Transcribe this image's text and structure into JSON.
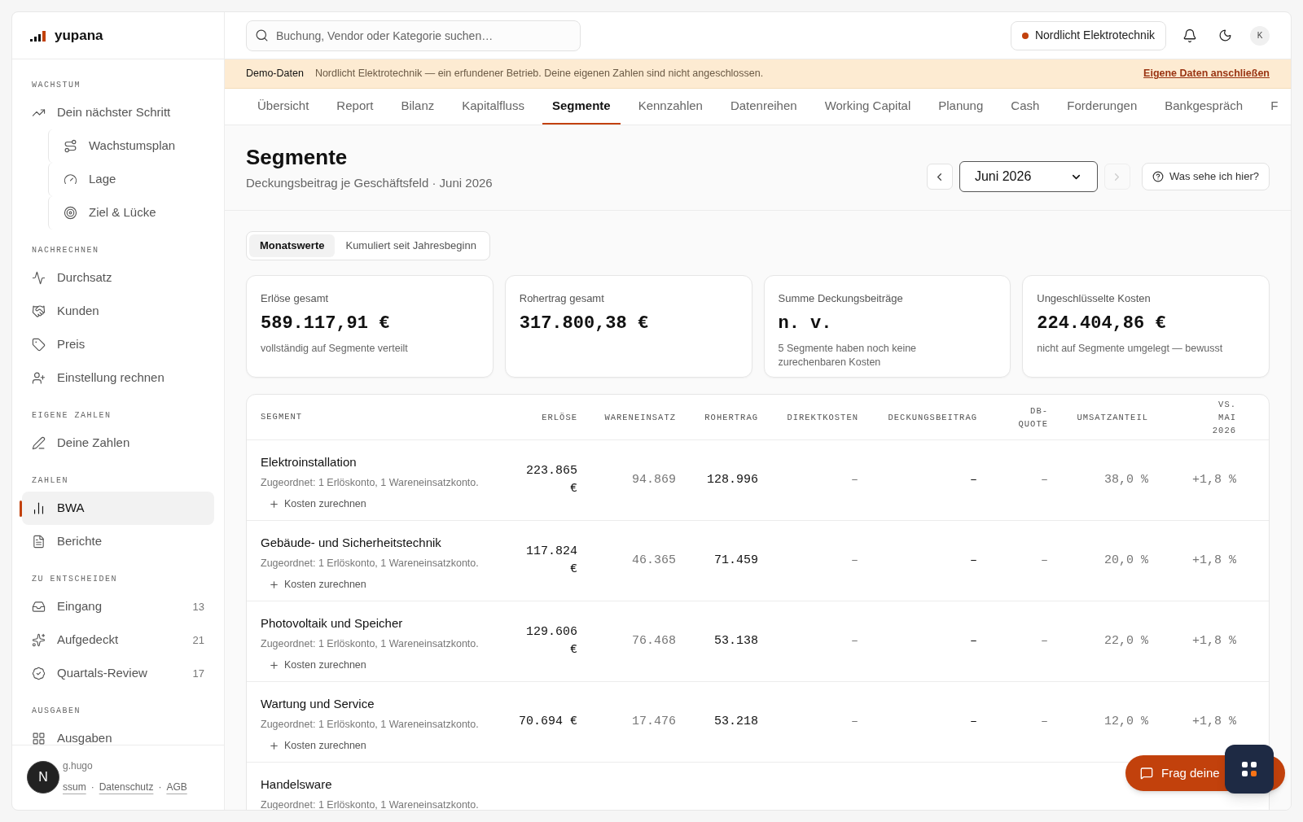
{
  "brand": {
    "name": "yupana"
  },
  "sidebar": {
    "sections": [
      {
        "title": "WACHSTUM",
        "items": [
          {
            "label": "Dein nächster Schritt",
            "selected": false,
            "children": [
              {
                "label": "Wachstumsplan",
                "selected": false
              },
              {
                "label": "Lage",
                "selected": false
              },
              {
                "label": "Ziel & Lücke",
                "selected": false
              }
            ]
          }
        ]
      },
      {
        "title": "NACHRECHNEN",
        "items": [
          {
            "label": "Durchsatz",
            "selected": false
          },
          {
            "label": "Kunden",
            "selected": false
          },
          {
            "label": "Preis",
            "selected": false
          },
          {
            "label": "Einstellung rechnen",
            "selected": false
          }
        ]
      },
      {
        "title": "EIGENE ZAHLEN",
        "items": [
          {
            "label": "Deine Zahlen",
            "selected": false
          }
        ]
      },
      {
        "title": "ZAHLEN",
        "items": [
          {
            "label": "BWA",
            "selected": true
          },
          {
            "label": "Berichte",
            "selected": false
          }
        ]
      },
      {
        "title": "ZU ENTSCHEIDEN",
        "items": [
          {
            "label": "Eingang",
            "selected": false,
            "count": "13"
          },
          {
            "label": "Aufgedeckt",
            "selected": false,
            "count": "21"
          },
          {
            "label": "Quartals-Review",
            "selected": false,
            "count": "17"
          }
        ]
      },
      {
        "title": "AUSGABEN",
        "items": [
          {
            "label": "Ausgaben",
            "selected": false
          }
        ]
      }
    ],
    "footer": {
      "credit": "g.hugo",
      "links": [
        "ssum",
        "Datenschutz",
        "AGB"
      ],
      "separator": "·"
    }
  },
  "dev_badge": "N",
  "header": {
    "search": {
      "placeholder": "Buchung, Vendor oder Kategorie suchen…"
    },
    "company": "Nordlicht Elektrotechnik",
    "avatar": "K"
  },
  "banner": {
    "label": "Demo-Daten",
    "text": "Nordlicht Elektrotechnik — ein erfundener Betrieb. Deine eigenen Zahlen sind nicht angeschlossen.",
    "link": "Eigene Daten anschließen"
  },
  "tabs": [
    {
      "label": "Übersicht",
      "selected": false
    },
    {
      "label": "Report",
      "selected": false
    },
    {
      "label": "Bilanz",
      "selected": false
    },
    {
      "label": "Kapitalfluss",
      "selected": false
    },
    {
      "label": "Segmente",
      "selected": true
    },
    {
      "label": "Kennzahlen",
      "selected": false
    },
    {
      "label": "Datenreihen",
      "selected": false
    },
    {
      "label": "Working Capital",
      "selected": false
    },
    {
      "label": "Planung",
      "selected": false
    },
    {
      "label": "Cash",
      "selected": false
    },
    {
      "label": "Forderungen",
      "selected": false
    },
    {
      "label": "Bankgespräch",
      "selected": false
    },
    {
      "label": "F",
      "selected": false
    }
  ],
  "page": {
    "title": "Segmente",
    "subtitle": "Deckungsbeitrag je Geschäftsfeld · Juni 2026",
    "month": "Juni 2026",
    "prev_disabled": false,
    "next_disabled": true,
    "help": "Was sehe ich hier?"
  },
  "modes": [
    {
      "label": "Monatswerte",
      "selected": true
    },
    {
      "label": "Kumuliert seit Jahresbeginn",
      "selected": false
    }
  ],
  "kpis": [
    {
      "label": "Erlöse gesamt",
      "value": "589.117,91 €",
      "note": "vollständig auf Segmente verteilt"
    },
    {
      "label": "Rohertrag gesamt",
      "value": "317.800,38 €"
    },
    {
      "label": "Summe Deckungsbeiträge",
      "value": "n. v.",
      "note": "5 Segmente haben noch keine zurechenbaren Kosten"
    },
    {
      "label": "Ungeschlüsselte Kosten",
      "value": "224.404,86 €",
      "note": "nicht auf Segmente umgelegt — bewusst"
    }
  ],
  "table": {
    "segment_header": "SEGMENT",
    "columns": [
      "ERLÖSE",
      "WARENEINSATZ",
      "ROHERTRAG",
      "DIREKTKOSTEN",
      "DECKUNGSBEITRAG",
      "DB-QUOTE",
      "UMSATZANTEIL",
      "VS. MAI 2026"
    ],
    "rows": [
      {
        "segment": {
          "name": "Elektroinstallation",
          "assigned": "Zugeordnet: 1 Erlöskonto, 1 Wareneinsatzkonto.",
          "action": "Kosten zurechnen"
        },
        "cells": [
          "223.865 €",
          "94.869",
          "128.996",
          "–",
          "–",
          "–",
          "38,0 %",
          "+1,8 %"
        ]
      },
      {
        "segment": {
          "name": "Gebäude- und Sicherheitstechnik",
          "assigned": "Zugeordnet: 1 Erlöskonto, 1 Wareneinsatzkonto.",
          "action": "Kosten zurechnen"
        },
        "cells": [
          "117.824 €",
          "46.365",
          "71.459",
          "–",
          "–",
          "–",
          "20,0 %",
          "+1,8 %"
        ]
      },
      {
        "segment": {
          "name": "Photovoltaik und Speicher",
          "assigned": "Zugeordnet: 1 Erlöskonto, 1 Wareneinsatzkonto.",
          "action": "Kosten zurechnen"
        },
        "cells": [
          "129.606 €",
          "76.468",
          "53.138",
          "–",
          "–",
          "–",
          "22,0 %",
          "+1,8 %"
        ]
      },
      {
        "segment": {
          "name": "Wartung und Service",
          "assigned": "Zugeordnet: 1 Erlöskonto, 1 Wareneinsatzkonto.",
          "action": "Kosten zurechnen"
        },
        "cells": [
          "70.694 €",
          "17.476",
          "53.218",
          "–",
          "–",
          "–",
          "12,0 %",
          "+1,8 %"
        ]
      },
      {
        "segment": {
          "name": "Handelsware",
          "assigned": "Zugeordnet: 1 Erlöskonto, 1 Wareneinsatzkonto."
        }
      }
    ]
  },
  "chat": {
    "label": "Frag deine"
  }
}
